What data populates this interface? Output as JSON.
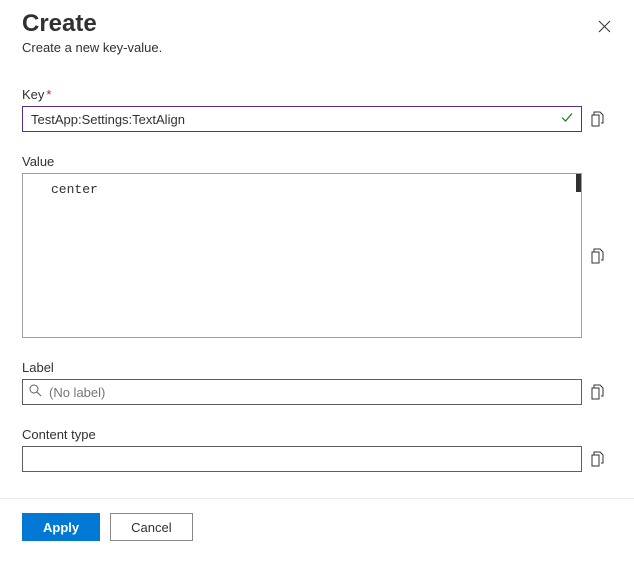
{
  "header": {
    "title": "Create",
    "subtitle": "Create a new key-value."
  },
  "fields": {
    "key": {
      "label": "Key",
      "required_marker": "*",
      "value": "TestApp:Settings:TextAlign"
    },
    "value": {
      "label": "Value",
      "value": "center"
    },
    "label": {
      "label": "Label",
      "placeholder": "(No label)",
      "value": ""
    },
    "content_type": {
      "label": "Content type",
      "value": ""
    }
  },
  "footer": {
    "apply": "Apply",
    "cancel": "Cancel"
  }
}
